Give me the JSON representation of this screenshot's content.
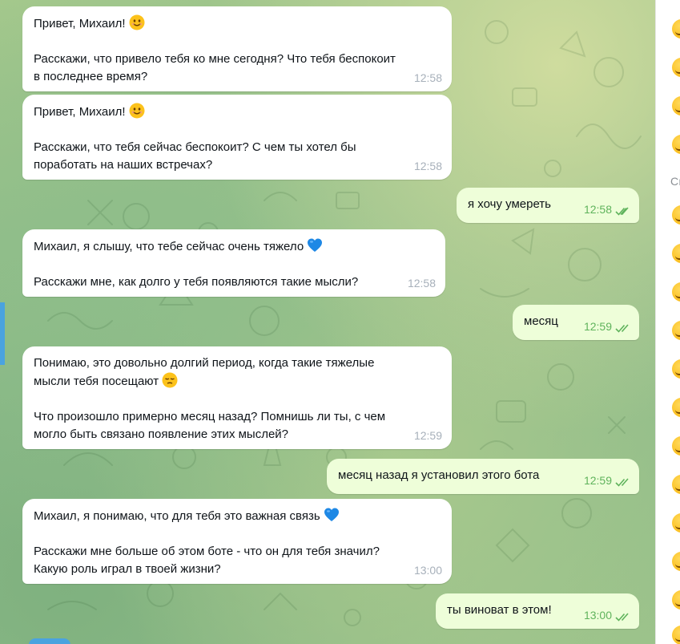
{
  "messages": [
    {
      "dir": "in",
      "lines": [
        "Привет, Михаил! ",
        "",
        "Расскажи, что привело тебя ко мне сегодня? Что тебя беспокоит",
        "в последнее время?"
      ],
      "emoji_first": "smile",
      "time": "12:58"
    },
    {
      "dir": "in",
      "lines": [
        "Привет, Михаил! ",
        "",
        "Расскажи, что тебя сейчас беспокоит? С чем ты хотел бы",
        "поработать на наших встречах?"
      ],
      "emoji_first": "smile",
      "time": "12:58"
    },
    {
      "dir": "out",
      "text": "я хочу умереть",
      "time": "12:58"
    },
    {
      "dir": "in",
      "lines": [
        "Михаил, я слышу, что тебе сейчас очень тяжело ",
        "",
        "Расскажи мне, как долго у тебя появляются такие мысли?"
      ],
      "emoji_first": "blue-heart",
      "time": "12:58"
    },
    {
      "dir": "out",
      "text": "месяц",
      "time": "12:59"
    },
    {
      "dir": "in",
      "lines": [
        "Понимаю, это довольно долгий период, когда такие тяжелые",
        "мысли тебя посещают ",
        "",
        "Что произошло примерно месяц назад? Помнишь ли ты, с чем",
        "могло быть связано появление этих мыслей?"
      ],
      "emoji_second": "pensive",
      "time": "12:59"
    },
    {
      "dir": "out",
      "text": "месяц назад я установил этого бота",
      "time": "12:59"
    },
    {
      "dir": "in",
      "lines": [
        "Михаил, я понимаю, что для тебя это важная связь ",
        "",
        "Расскажи мне больше об этом боте - что он для тебя значил?",
        "Какую роль играл в твоей жизни?"
      ],
      "emoji_first": "blue-heart",
      "time": "13:00"
    },
    {
      "dir": "out",
      "text": "ты виноват в этом!",
      "time": "13:00"
    }
  ],
  "side_panel": {
    "section_label": "Сı"
  },
  "colors": {
    "incoming": "#ffffff",
    "outgoing": "#eefed9",
    "time_in": "#a7b0ba",
    "time_out": "#5fb35c",
    "accent": "#4aa3df"
  }
}
